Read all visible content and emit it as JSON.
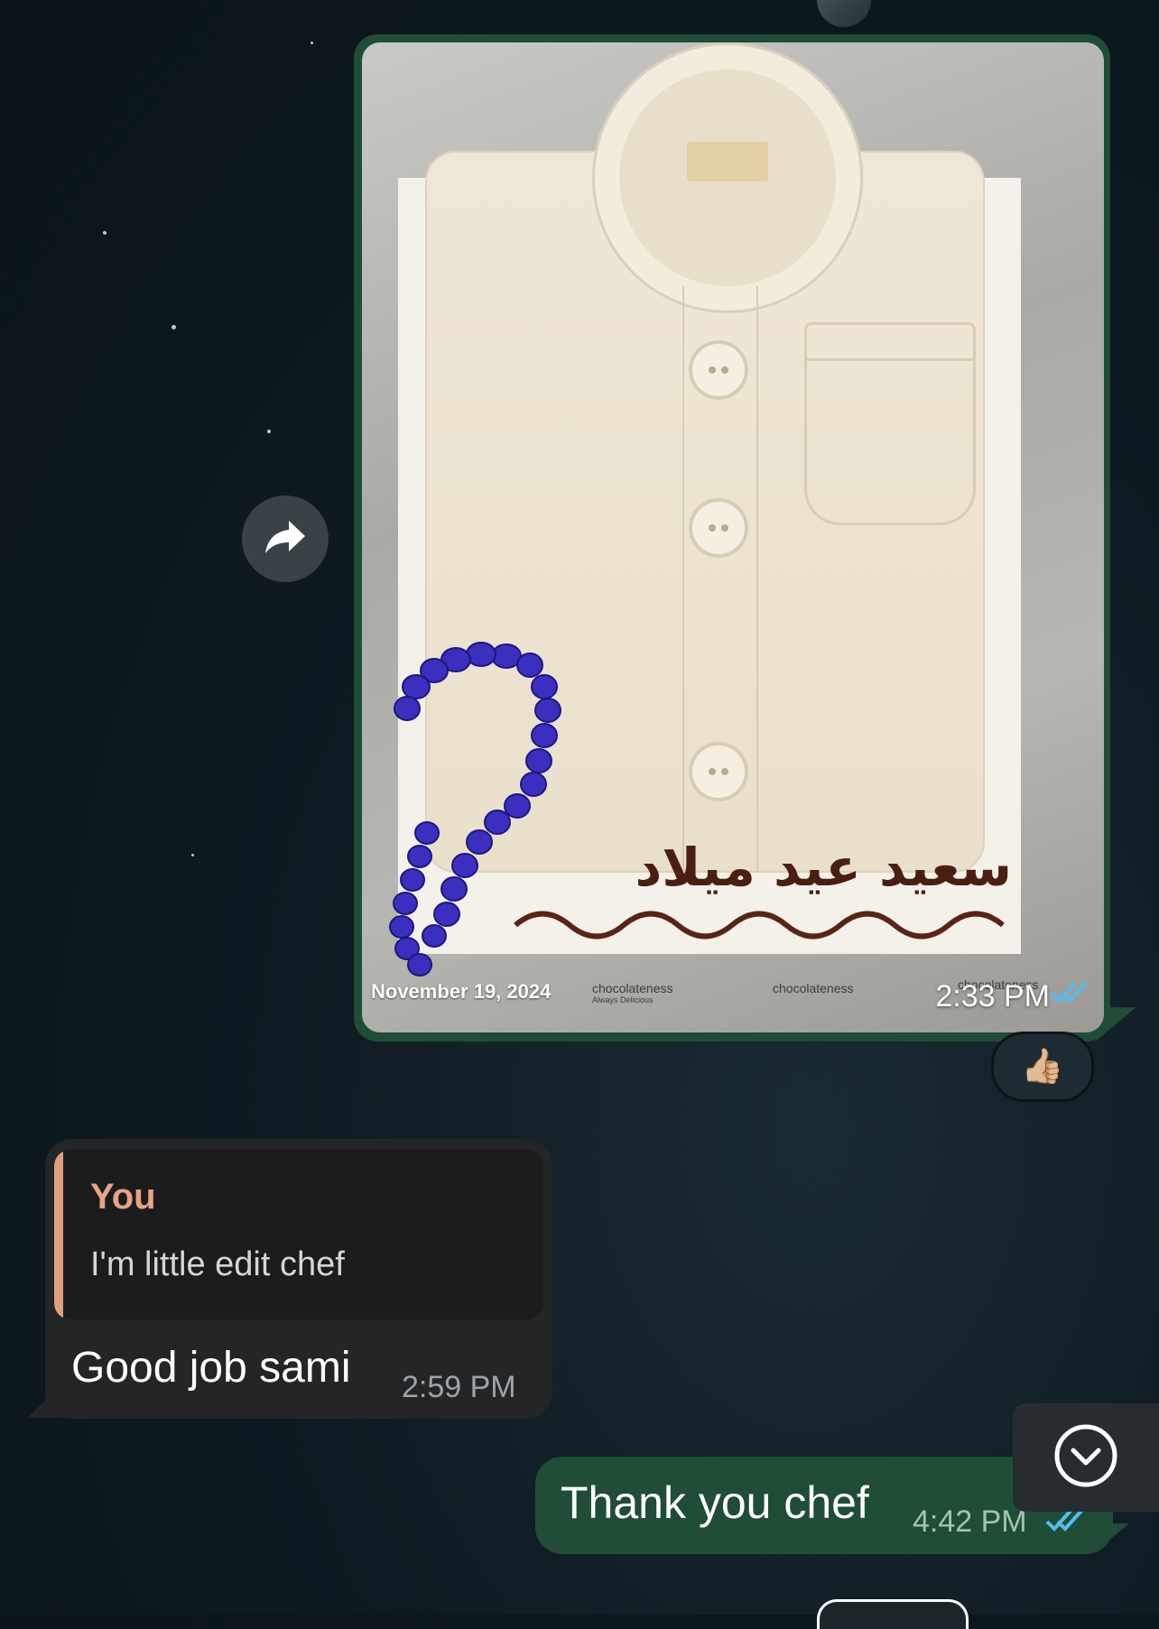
{
  "conversation": {
    "image_message": {
      "date_overlay": "November 19, 2024",
      "time": "2:33 PM",
      "reaction_emoji": "👍🏼",
      "photo_caption_watermark": "chocolateness",
      "photo_watermark_sub": "Always Delicious",
      "photo_arabic_text": "سعيد عيد ميلاد"
    },
    "reply_message": {
      "quoted_author": "You",
      "quoted_text": "I'm little edit chef",
      "text": "Good job sami",
      "time": "2:59 PM"
    },
    "outgoing_message": {
      "text": "Thank you chef",
      "time": "4:42 PM"
    }
  },
  "icons": {
    "forward": "forward-arrow-icon",
    "scroll_down": "chevron-down-circle-icon",
    "read_receipt": "double-check-icon"
  },
  "colors": {
    "outgoing_bubble": "#1f4d35",
    "incoming_bubble": "#242526",
    "quote_accent": "#e0a07e",
    "read_receipt": "#53bdeb"
  }
}
